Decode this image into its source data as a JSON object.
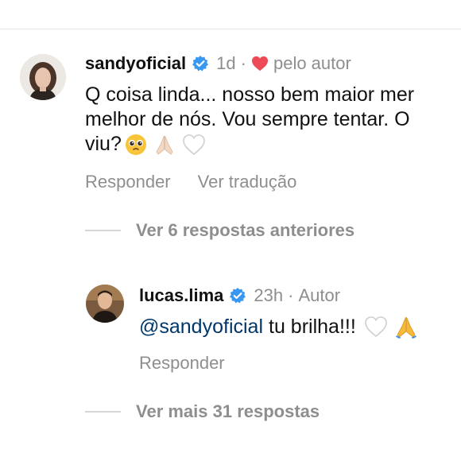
{
  "main_comment": {
    "username": "sandyoficial",
    "time": "1d",
    "separator": "·",
    "liked_by_author_label": "pelo autor",
    "text_lines": [
      "Q coisa linda... nosso bem maior mer",
      "melhor de nós. Vou sempre tentar. O",
      "viu?"
    ],
    "emojis": [
      "pleading-face",
      "folded-hands",
      "white-heart"
    ],
    "actions": {
      "reply_label": "Responder",
      "translate_label": "Ver tradução"
    }
  },
  "previous_replies_label": "Ver 6 respostas anteriores",
  "reply": {
    "username": "lucas.lima",
    "time": "23h",
    "separator": "·",
    "author_label": "Autor",
    "mention": "@sandyoficial",
    "text": "tu brilha!!!",
    "emojis": [
      "white-heart",
      "folded-hands"
    ],
    "actions": {
      "reply_label": "Responder"
    }
  },
  "more_replies_label": "Ver mais 31 respostas",
  "colors": {
    "verified": "#3897f0",
    "heart": "#ed4956",
    "gray_text": "#8e8e8e",
    "mention": "#00376b"
  }
}
